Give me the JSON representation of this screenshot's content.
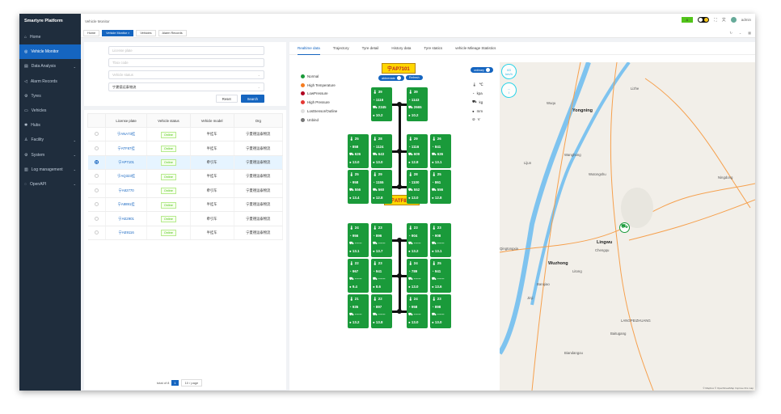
{
  "app": {
    "title": "Smartyre Platform"
  },
  "sidebar": {
    "items": [
      {
        "label": "Home",
        "icon": "home-icon"
      },
      {
        "label": "Vehicle Monitor",
        "icon": "monitor-icon",
        "active": true
      },
      {
        "label": "Data Analysis",
        "icon": "chart-icon",
        "chevron": true
      },
      {
        "label": "Alarm Records",
        "icon": "alarm-icon"
      },
      {
        "label": "Tyres",
        "icon": "tyre-icon"
      },
      {
        "label": "Vehicles",
        "icon": "vehicle-icon"
      },
      {
        "label": "Hubs",
        "icon": "hub-icon"
      },
      {
        "label": "Facility",
        "icon": "facility-icon",
        "chevron": true
      },
      {
        "label": "System",
        "icon": "system-icon",
        "chevron": true
      },
      {
        "label": "Log management",
        "icon": "log-icon",
        "chevron": true
      },
      {
        "label": "OpenAPI",
        "icon": "api-icon",
        "chevron": true
      }
    ]
  },
  "header": {
    "breadcrumb": "Vehicle Monitor",
    "user": "admin",
    "lang_badge": "A"
  },
  "tags": [
    {
      "label": "Home"
    },
    {
      "label": "Vehicle Monitor ×",
      "active": true
    },
    {
      "label": "Vehicles"
    },
    {
      "label": "Alarm Records"
    }
  ],
  "filter": {
    "license_placeholder": "License plate",
    "tbox_placeholder": "Tbox code",
    "status_placeholder": "Vehicle status",
    "org_value": "宁夏德运泰物流",
    "reset": "Reset",
    "search": "Search"
  },
  "table": {
    "headers": [
      "",
      "License plate",
      "Vehicle status",
      "Vehicle model",
      "Org"
    ],
    "rows": [
      {
        "plate": "宁ANA73挂",
        "status": "Online",
        "model": "半挂车",
        "org": "宁夏德运泰物流"
      },
      {
        "plate": "宁ATF87挂",
        "status": "Online",
        "model": "半挂车",
        "org": "宁夏德运泰物流"
      },
      {
        "plate": "宁AP7101",
        "status": "Online",
        "model": "牵引车",
        "org": "宁夏德运泰物流",
        "selected": true
      },
      {
        "plate": "宁AQ323挂",
        "status": "Online",
        "model": "半挂车",
        "org": "宁夏德运泰物流"
      },
      {
        "plate": "宁A82770",
        "status": "Online",
        "model": "牵引车",
        "org": "宁夏德运泰物流"
      },
      {
        "plate": "宁A8891挂",
        "status": "Online",
        "model": "半挂车",
        "org": "宁夏德运泰物流"
      },
      {
        "plate": "宁AE2901",
        "status": "Online",
        "model": "牵引车",
        "org": "宁夏德运泰物流"
      },
      {
        "plate": "宁AE9116",
        "status": "Online",
        "model": "半挂车",
        "org": "宁夏德运泰物流"
      }
    ]
  },
  "pagination": {
    "total": "total of 8",
    "page": "1",
    "page_size": "10 / page"
  },
  "tabs": [
    "Realtime data",
    "Trajectory",
    "Tyre detail",
    "History data",
    "Tyre statics",
    "vehicle Mileage Statistics"
  ],
  "legend": [
    {
      "label": "Normal",
      "color": "#1a9a3a"
    },
    {
      "label": "High Temperature",
      "color": "#f57c1f"
    },
    {
      "label": "LowPressure",
      "color": "#b00020"
    },
    {
      "label": "High Pressure",
      "color": "#e53935"
    },
    {
      "label": "LostSensor/Outline",
      "color": "#e0e0e0"
    },
    {
      "label": "Unbind",
      "color": "#777777"
    }
  ],
  "controls": {
    "abbreviate": "abbreviate",
    "refresh": "Refresh",
    "ordinary": "ordinary"
  },
  "units": [
    {
      "icon": "thermometer-icon",
      "label": "℃"
    },
    {
      "icon": "pressure-icon",
      "label": "kpa"
    },
    {
      "icon": "load-icon",
      "label": "kg"
    },
    {
      "icon": "tread-icon",
      "label": "mm"
    },
    {
      "icon": "voltage-icon",
      "label": "V"
    }
  ],
  "tractor": {
    "plate": "宁AP7101",
    "tyres": [
      {
        "t": "39",
        "p": "1116",
        "l": "2345",
        "d": "10.2"
      },
      {
        "t": "39",
        "p": "1143",
        "l": "2665",
        "d": "10.2"
      },
      {
        "t": "25",
        "p": "858",
        "l": "626",
        "d": "13.0"
      },
      {
        "t": "28",
        "p": "1124",
        "l": "643",
        "d": "13.0"
      },
      {
        "t": "29",
        "p": "1116",
        "l": "609",
        "d": "12.8"
      },
      {
        "t": "26",
        "p": "841",
        "l": "626",
        "d": "13.1"
      },
      {
        "t": "25",
        "p": "958",
        "l": "556",
        "d": "13.4"
      },
      {
        "t": "29",
        "p": "1155",
        "l": "560",
        "d": "12.8"
      },
      {
        "t": "28",
        "p": "1100",
        "l": "552",
        "d": "13.0"
      },
      {
        "t": "25",
        "p": "861",
        "l": "556",
        "d": "12.8"
      }
    ]
  },
  "trailer": {
    "plate": "宁ATF87挂",
    "tyres": [
      {
        "t": "24",
        "p": "956",
        "l": "------",
        "d": "13.1"
      },
      {
        "t": "23",
        "p": "896",
        "l": "------",
        "d": "13.7"
      },
      {
        "t": "23",
        "p": "904",
        "l": "------",
        "d": "13.2"
      },
      {
        "t": "23",
        "p": "908",
        "l": "------",
        "d": "13.1"
      },
      {
        "t": "22",
        "p": "967",
        "l": "------",
        "d": "9.4"
      },
      {
        "t": "23",
        "p": "941",
        "l": "------",
        "d": "8.6"
      },
      {
        "t": "24",
        "p": "789",
        "l": "------",
        "d": "13.0"
      },
      {
        "t": "25",
        "p": "941",
        "l": "------",
        "d": "13.6"
      },
      {
        "t": "21",
        "p": "935",
        "l": "------",
        "d": "13.2"
      },
      {
        "t": "22",
        "p": "897",
        "l": "------",
        "d": "13.8"
      },
      {
        "t": "24",
        "p": "958",
        "l": "------",
        "d": "13.0"
      },
      {
        "t": "23",
        "p": "898",
        "l": "------",
        "d": "13.0"
      }
    ]
  },
  "map": {
    "speed": "63",
    "speed_unit": "km/h",
    "heading": "--",
    "heading_sub": "I",
    "labels": [
      "Yongning",
      "Lingwu",
      "Wuzhong",
      "Litong",
      "Chengqu",
      "Wuqu",
      "Wanghong",
      "Wutongshu",
      "Lijun",
      "Ningdong",
      "Lizhe",
      "Banqiao",
      "Jinji",
      "Baitugang",
      "Biandangou",
      "LANGPEIZHUANG",
      "Qingtongxia"
    ],
    "attribution": "© Mapbox © OpenStreetMap  Improve this map"
  }
}
